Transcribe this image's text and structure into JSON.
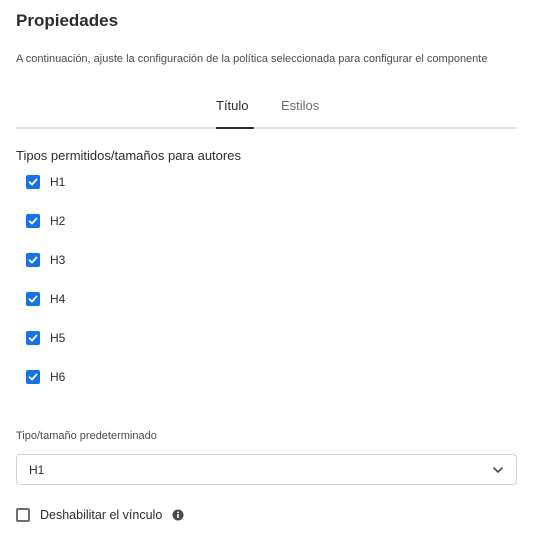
{
  "header": {
    "title": "Propiedades",
    "description": "A continuación, ajuste la configuración de la política seleccionada para configurar el componente"
  },
  "tabs": [
    {
      "label": "Título",
      "active": true
    },
    {
      "label": "Estilos",
      "active": false
    }
  ],
  "allowed_types": {
    "label": "Tipos permitidos/tamaños para autores",
    "items": [
      {
        "label": "H1",
        "checked": true
      },
      {
        "label": "H2",
        "checked": true
      },
      {
        "label": "H3",
        "checked": true
      },
      {
        "label": "H4",
        "checked": true
      },
      {
        "label": "H5",
        "checked": true
      },
      {
        "label": "H6",
        "checked": true
      }
    ]
  },
  "default_type": {
    "label": "Tipo/tamaño predeterminado",
    "value": "H1"
  },
  "disable_link": {
    "label": "Deshabilitar el vínculo",
    "checked": false,
    "icon": "info-icon"
  },
  "colors": {
    "accent": "#1473e6",
    "text": "#2c2c2c",
    "muted": "#6e6e6e"
  }
}
